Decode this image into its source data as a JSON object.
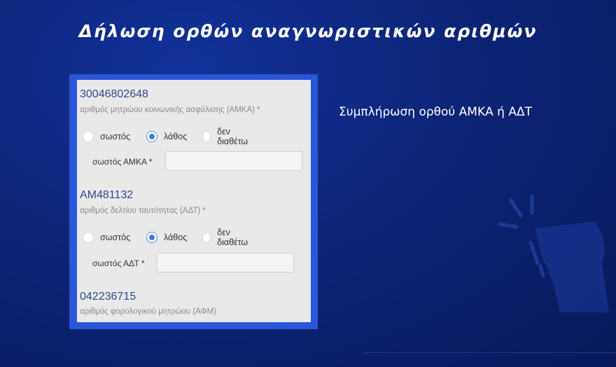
{
  "slide": {
    "title": "Δήλωση ορθών αναγνωριστικών αριθμών",
    "caption": "Συμπλήρωση ορθού ΑΜΚΑ ή ΑΔΤ"
  },
  "form": {
    "amka": {
      "value": "30046802648",
      "label": "αριθμός μητρώου κοινωνικής ασφάλισης (ΑΜΚΑ) *",
      "options": [
        "σωστός",
        "λάθος",
        "δεν διαθέτω"
      ],
      "selected": "λάθος",
      "correct_label": "σωστός ΑΜΚΑ *",
      "correct_value": ""
    },
    "adt": {
      "value": "AM481132",
      "label": "αριθμός δελτίου ταυτότητας (ΑΔΤ) *",
      "options": [
        "σωστός",
        "λάθος",
        "δεν διαθέτω"
      ],
      "selected": "λάθος",
      "correct_label": "σωστός ΑΔΤ *",
      "correct_value": ""
    },
    "afm": {
      "value": "042236715",
      "label": "αριθμός φορολογικού μητρώου (ΑΦΜ)"
    }
  },
  "colors": {
    "background": "#0d2477",
    "frame": "#2a56d8",
    "form_bg": "#e9e9e9",
    "value_text": "#2b4a8a",
    "radio_checked": "#3d7be0"
  }
}
